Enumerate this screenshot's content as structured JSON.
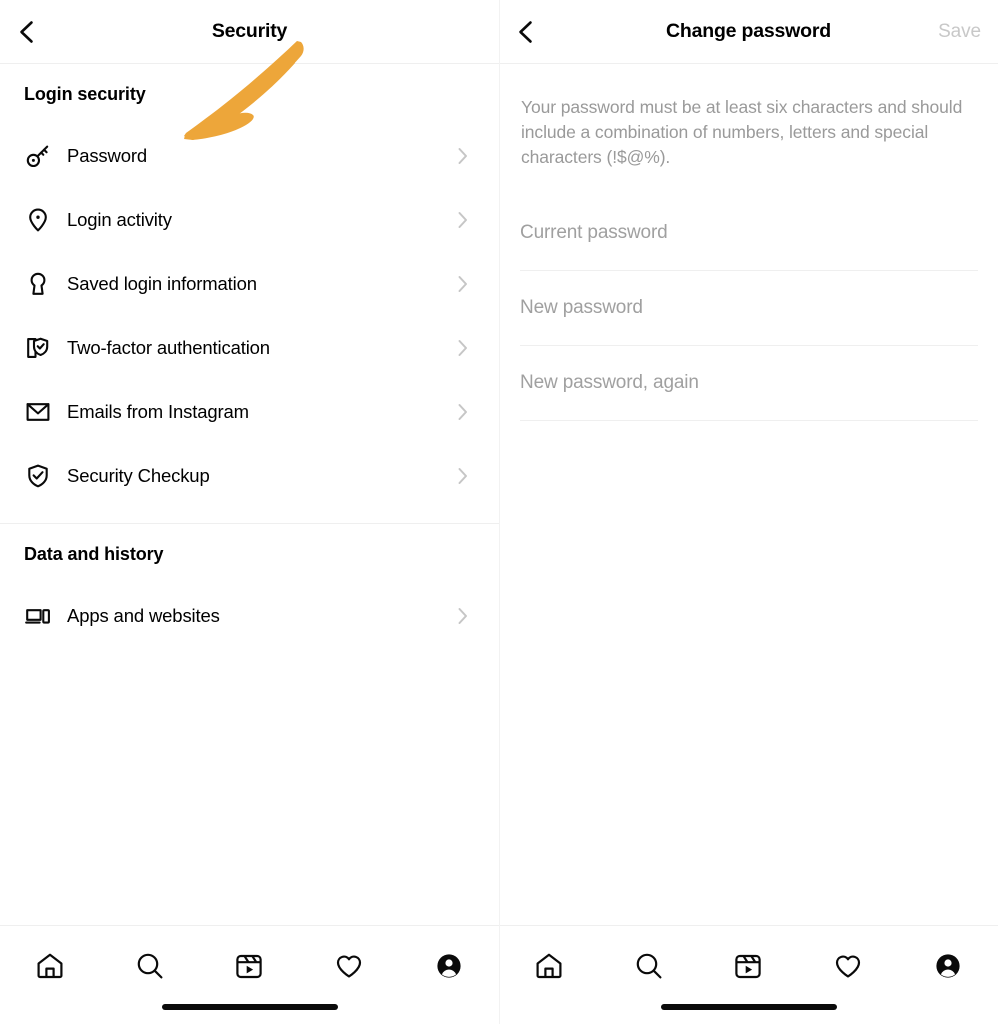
{
  "colors": {
    "accent_annotation": "#eda63a",
    "text_primary": "#000000",
    "text_muted": "#9a9a9a",
    "divider": "#efefef",
    "disabled_action": "#c8c8c8",
    "background": "#ffffff"
  },
  "left_screen": {
    "header": {
      "back_icon": "chevron-left-icon",
      "title": "Security"
    },
    "sections": [
      {
        "title": "Login security",
        "items": [
          {
            "label": "Password",
            "icon": "key-icon"
          },
          {
            "label": "Login activity",
            "icon": "location-pin-icon"
          },
          {
            "label": "Saved login information",
            "icon": "keyhole-icon"
          },
          {
            "label": "Two-factor authentication",
            "icon": "phone-shield-check-icon"
          },
          {
            "label": "Emails from Instagram",
            "icon": "envelope-icon"
          },
          {
            "label": "Security Checkup",
            "icon": "shield-check-icon"
          }
        ]
      },
      {
        "title": "Data and history",
        "items": [
          {
            "label": "Apps and websites",
            "icon": "devices-icon"
          }
        ]
      }
    ],
    "annotation": {
      "type": "hand-drawn-arrow",
      "points_to": "Password",
      "color": "#eda63a"
    },
    "tabbar": {
      "tabs": [
        {
          "icon": "home-icon",
          "label": "Home"
        },
        {
          "icon": "search-icon",
          "label": "Search"
        },
        {
          "icon": "reels-icon",
          "label": "Reels"
        },
        {
          "icon": "heart-icon",
          "label": "Activity"
        },
        {
          "icon": "profile-avatar-icon",
          "label": "Profile"
        }
      ]
    }
  },
  "right_screen": {
    "header": {
      "back_icon": "chevron-left-icon",
      "title": "Change password",
      "action_label": "Save",
      "action_enabled": false
    },
    "description": "Your password must be at least six characters and should include a combination of numbers, letters and special characters (!$@%).",
    "fields": [
      {
        "name": "current-password",
        "placeholder": "Current password",
        "value": ""
      },
      {
        "name": "new-password",
        "placeholder": "New password",
        "value": ""
      },
      {
        "name": "new-password-again",
        "placeholder": "New password, again",
        "value": ""
      }
    ],
    "tabbar": {
      "tabs": [
        {
          "icon": "home-icon",
          "label": "Home"
        },
        {
          "icon": "search-icon",
          "label": "Search"
        },
        {
          "icon": "reels-icon",
          "label": "Reels"
        },
        {
          "icon": "heart-icon",
          "label": "Activity"
        },
        {
          "icon": "profile-avatar-icon",
          "label": "Profile"
        }
      ]
    }
  }
}
